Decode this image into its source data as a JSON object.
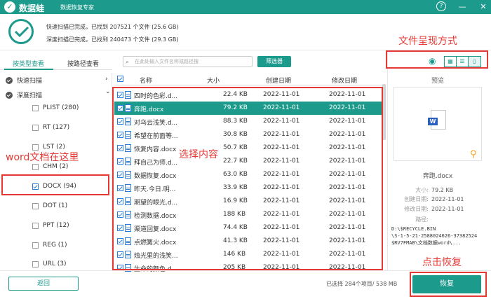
{
  "app": {
    "logo_char": "✓",
    "name": "数据蛙",
    "subtitle": "数据恢复专家",
    "help": "?",
    "minimize": "—",
    "close": "✕"
  },
  "scan": {
    "quick": "快速扫描已完成，已找到  207521 个文件  (25.6 GB)",
    "deep": "深度扫描已完成，已找到  240473 个文件  (29.3 GB)"
  },
  "left_tabs": {
    "by_type": "按类型查看",
    "by_path": "按路径查看"
  },
  "tree": {
    "quick_scan": "快速扫描",
    "deep_scan": "深度扫描",
    "chevron": "›",
    "chevron_down": "⌄",
    "items": [
      {
        "label": "PLIST (280)"
      },
      {
        "label": "RT (127)"
      },
      {
        "label": "LST (2)"
      },
      {
        "label": "CHM (2)"
      },
      {
        "label": "DOCX (94)"
      },
      {
        "label": "DOT (1)"
      },
      {
        "label": "PPT (12)"
      },
      {
        "label": "REG (1)"
      },
      {
        "label": "URL (3)"
      }
    ]
  },
  "search": {
    "placeholder": "在此处输入文件名称或路径搜",
    "icon": "⌕"
  },
  "filter_label": "筛选器",
  "table": {
    "headers": {
      "name": "名称",
      "size": "大小",
      "created": "创建日期",
      "modified": "修改日期"
    },
    "rows": [
      {
        "name": "四时的色彩.d...",
        "size": "22.4 KB",
        "created": "2022-11-01",
        "modified": "2022-11-01"
      },
      {
        "name": "奔跑.docx",
        "size": "79.2 KB",
        "created": "2022-11-01",
        "modified": "2022-11-01"
      },
      {
        "name": "对乌云浅笑.d...",
        "size": "88.3 KB",
        "created": "2022-11-01",
        "modified": "2022-11-01"
      },
      {
        "name": "希望在前面等...",
        "size": "30.8 KB",
        "created": "2022-11-01",
        "modified": "2022-11-01"
      },
      {
        "name": "恢复内容.docx",
        "size": "50.7 KB",
        "created": "2022-11-01",
        "modified": "2022-11-01"
      },
      {
        "name": "拜自己为师.d...",
        "size": "22.7 KB",
        "created": "2022-11-01",
        "modified": "2022-11-01"
      },
      {
        "name": "数据恢复.docx",
        "size": "63.0 KB",
        "created": "2022-11-01",
        "modified": "2022-11-01"
      },
      {
        "name": "昨天.今日.明...",
        "size": "33.9 KB",
        "created": "2022-11-01",
        "modified": "2022-11-01"
      },
      {
        "name": "期望的眼光.d...",
        "size": "16.9 KB",
        "created": "2022-11-01",
        "modified": "2022-11-01"
      },
      {
        "name": "检测数据.docx",
        "size": "188 KB",
        "created": "2022-11-01",
        "modified": "2022-11-01"
      },
      {
        "name": "渠道回复.docx",
        "size": "74.4 KB",
        "created": "2022-11-01",
        "modified": "2022-11-01"
      },
      {
        "name": "点燃篝火.docx",
        "size": "41.3 KB",
        "created": "2022-11-01",
        "modified": "2022-11-01"
      },
      {
        "name": "烛光里的浅笑...",
        "size": "146 KB",
        "created": "2022-11-01",
        "modified": "2022-11-01"
      },
      {
        "name": "生命的颜色.d...",
        "size": "205 KB",
        "created": "2022-11-01",
        "modified": "2022-11-01"
      }
    ]
  },
  "preview": {
    "eye_icon": "◉",
    "view_icons": [
      "▦",
      "☰",
      "▯"
    ],
    "title": "预览",
    "word_letter": "W",
    "zoom_icon": "⚲",
    "filename": "奔跑.docx",
    "size_label": "大小:",
    "size_value": "79.2 KB",
    "created_label": "创建日期:",
    "created_value": "2022-11-01",
    "modified_label": "修改日期:",
    "modified_value": "2022-11-01",
    "path_label": "路径:",
    "path_line1": "D:\\$RECYCLE.BIN",
    "path_line2": "\\S-1-5-21-2588024626-37382524",
    "path_line3": "$RV7FMAB\\文档数据word\\..."
  },
  "footer": {
    "back": "返回",
    "selected_info": "已选择 284个项目/ 538 MB",
    "recover": "恢复"
  },
  "annotations": {
    "view_mode": "文件呈现方式",
    "word_here": "word文档在这里",
    "select_content": "选择内容",
    "click_recover": "点击恢复"
  }
}
